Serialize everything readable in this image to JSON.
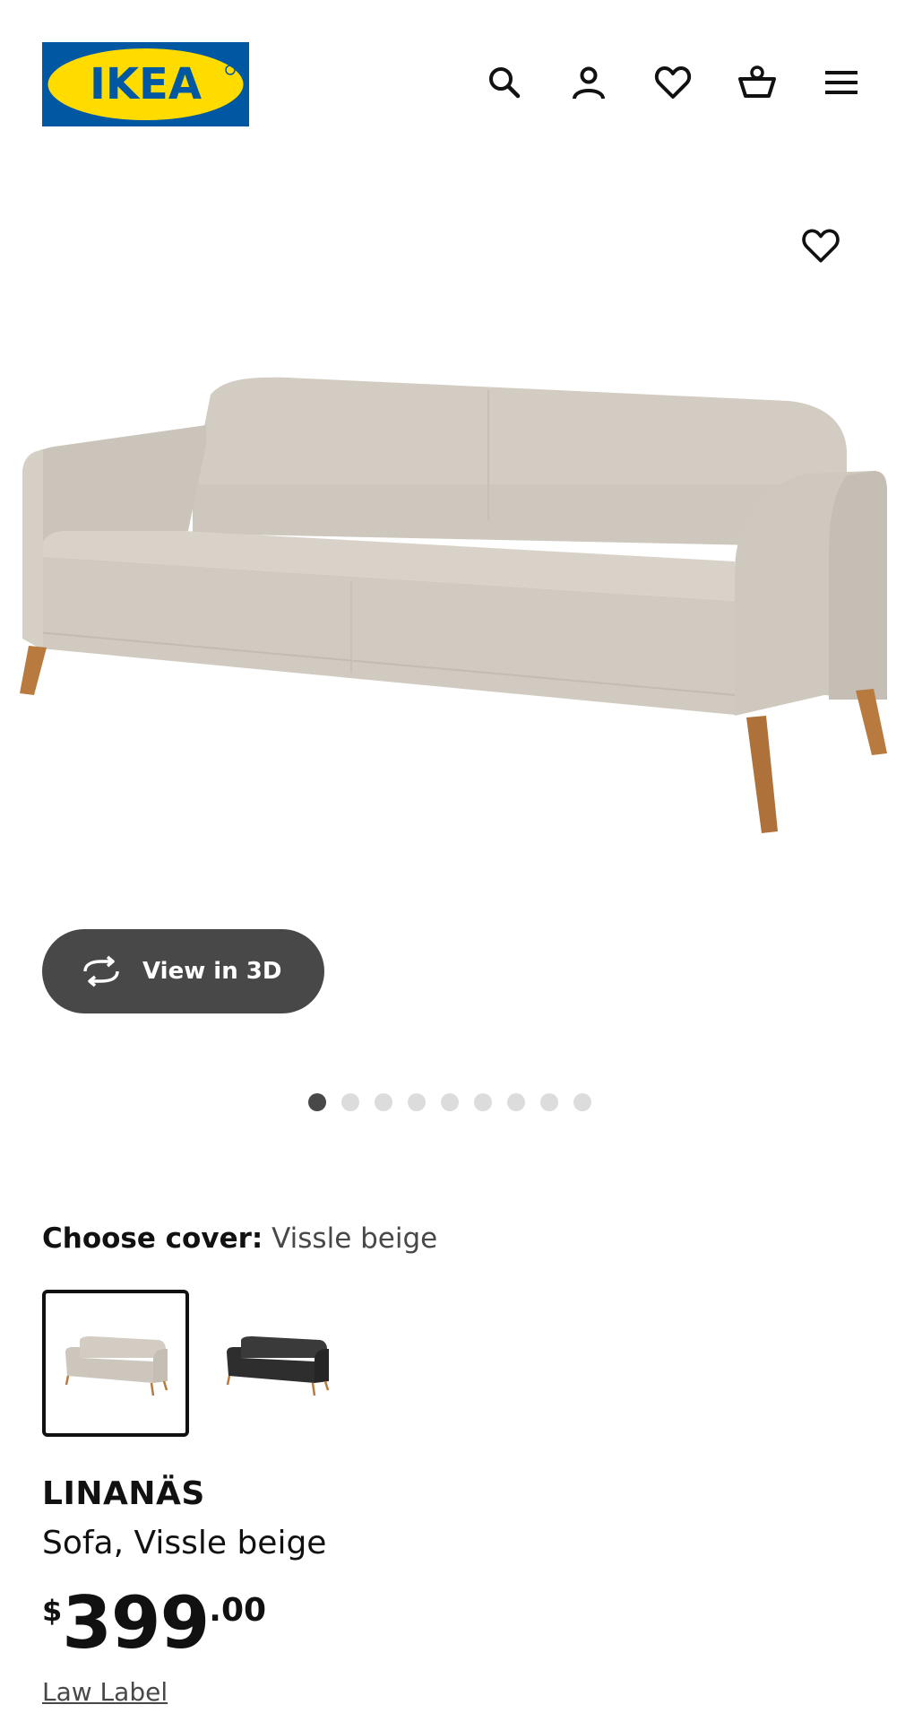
{
  "header": {
    "logo_text": "IKEA",
    "icons": [
      "search-icon",
      "account-icon",
      "heart-icon",
      "basket-icon",
      "menu-icon"
    ]
  },
  "gallery": {
    "favorite_icon": "heart-icon",
    "image_alt": "LINANÄS sofa in Vissle beige",
    "view3d_label": "View in 3D",
    "slide_count": 9,
    "active_slide": 1
  },
  "cover": {
    "label": "Choose cover:",
    "value": "Vissle beige",
    "options": [
      "Vissle beige",
      "Vissle dark grey"
    ],
    "selected": 0
  },
  "product": {
    "name": "LINANÄS",
    "description": "Sofa, Vissle beige",
    "price_currency": "$",
    "price_int": "399",
    "price_dec": ".00",
    "law_label": "Law Label"
  },
  "colors": {
    "brand_blue": "#0058a3",
    "brand_yellow": "#ffdb00",
    "dark_button": "#484848"
  }
}
